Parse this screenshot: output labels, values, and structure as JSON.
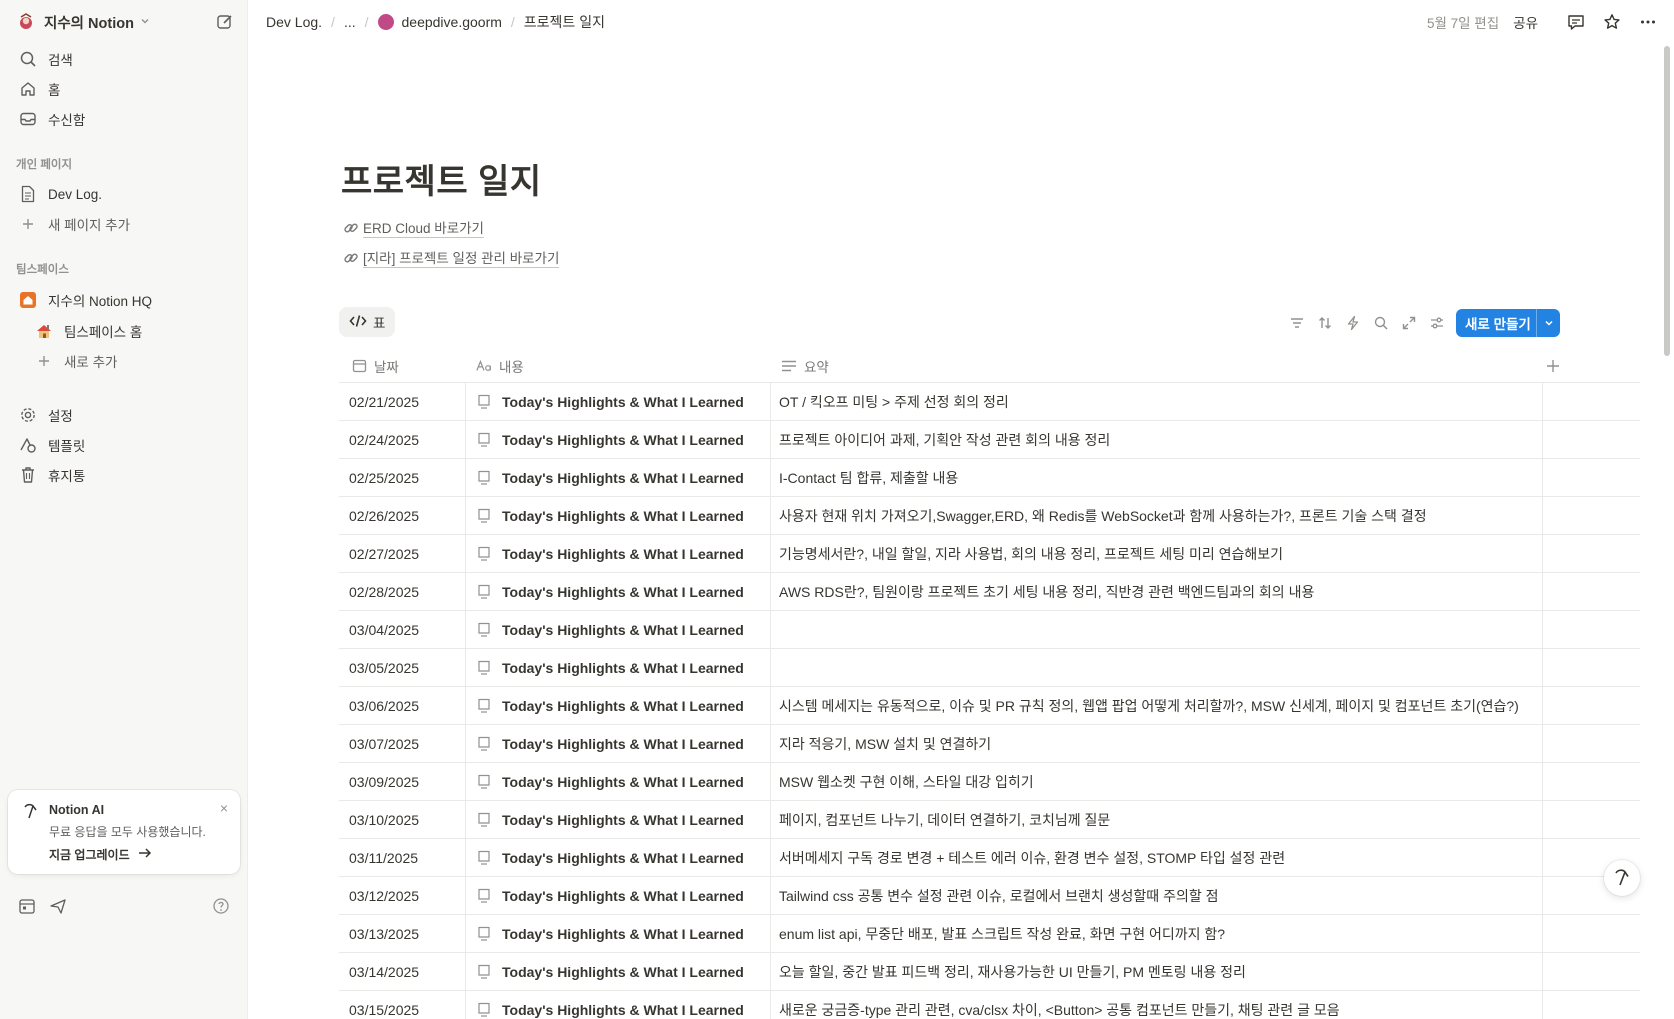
{
  "sidebar": {
    "workspace_name": "지수의 Notion",
    "nav": [
      {
        "label": "검색",
        "icon": "search-icon"
      },
      {
        "label": "홈",
        "icon": "home-icon"
      },
      {
        "label": "수신함",
        "icon": "inbox-icon"
      }
    ],
    "private_section": "개인 페이지",
    "private_pages": [
      {
        "label": "Dev Log.",
        "icon": "page-icon"
      },
      {
        "label": "새 페이지 추가",
        "icon": "plus-icon"
      }
    ],
    "teamspace_section": "팀스페이스",
    "teamspaces": [
      {
        "label": "지수의 Notion HQ",
        "icon": "hq-icon"
      },
      {
        "label": "팀스페이스 홈",
        "icon": "house-emoji-icon"
      },
      {
        "label": "새로 추가",
        "icon": "plus-icon"
      }
    ],
    "tools": [
      {
        "label": "설정",
        "icon": "gear-icon"
      },
      {
        "label": "템플릿",
        "icon": "template-icon"
      },
      {
        "label": "휴지통",
        "icon": "trash-icon"
      }
    ],
    "ai_card": {
      "title": "Notion AI",
      "description": "무료 응답을 모두 사용했습니다.",
      "upgrade": "지금 업그레이드",
      "close": "×"
    }
  },
  "topbar": {
    "breadcrumbs": [
      "Dev Log.",
      "...",
      "deepdive.goorm",
      "프로젝트 일지"
    ],
    "edited": "5월 7일 편집",
    "share": "공유"
  },
  "page": {
    "title": "프로젝트 일지",
    "links": [
      {
        "text": "ERD Cloud 바로가기",
        "icon": "link-icon"
      },
      {
        "text": "[지라] 프로젝트 일정 관리 바로가기",
        "icon": "link-icon"
      }
    ],
    "view_tab": "표",
    "new_button": "새로 만들기"
  },
  "table": {
    "columns": [
      {
        "label": "날짜",
        "icon": "calendar-icon"
      },
      {
        "label": "내용",
        "icon": "text-aa-icon"
      },
      {
        "label": "요약",
        "icon": "lines-icon"
      }
    ],
    "rows": [
      {
        "date": "02/21/2025",
        "title": "Today's Highlights & What I Learned",
        "summary": "OT / 킥오프 미팅 > 주제 선정 회의 정리"
      },
      {
        "date": "02/24/2025",
        "title": "Today's Highlights & What I Learned",
        "summary": "프로젝트 아이디어 과제, 기획안 작성 관련 회의 내용 정리"
      },
      {
        "date": "02/25/2025",
        "title": "Today's Highlights & What I Learned",
        "summary": "I-Contact 팀 합류, 제출할 내용"
      },
      {
        "date": "02/26/2025",
        "title": "Today's Highlights & What I Learned",
        "summary": "사용자 현재 위치 가져오기,Swagger,ERD, 왜 Redis를 WebSocket과 함께 사용하는가?, 프론트 기술 스택 결정"
      },
      {
        "date": "02/27/2025",
        "title": "Today's Highlights & What I Learned",
        "summary": "기능명세서란?, 내일 할일, 지라 사용법, 회의 내용 정리, 프로젝트 세팅 미리 연습해보기"
      },
      {
        "date": "02/28/2025",
        "title": "Today's Highlights & What I Learned",
        "summary": "AWS RDS란?, 팀원이랑 프로젝트 초기 세팅 내용 정리, 직반경 관련 백엔드팀과의 회의 내용"
      },
      {
        "date": "03/04/2025",
        "title": "Today's Highlights & What I Learned",
        "summary": ""
      },
      {
        "date": "03/05/2025",
        "title": "Today's Highlights & What I Learned",
        "summary": ""
      },
      {
        "date": "03/06/2025",
        "title": "Today's Highlights & What I Learned",
        "summary": "시스템 메세지는 유동적으로, 이슈 및 PR 규칙 정의, 웹앱 팝업 어떻게 처리할까?, MSW 신세계, 페이지 및 컴포넌트 초기(연습?)"
      },
      {
        "date": "03/07/2025",
        "title": "Today's Highlights & What I Learned",
        "summary": "지라 적응기, MSW 설치 및 연결하기"
      },
      {
        "date": "03/09/2025",
        "title": "Today's Highlights & What I Learned",
        "summary": "MSW 웹소켓 구현 이해, 스타일 대강 입히기"
      },
      {
        "date": "03/10/2025",
        "title": "Today's Highlights & What I Learned",
        "summary": "페이지, 컴포넌트 나누기, 데이터 연결하기, 코치님께 질문"
      },
      {
        "date": "03/11/2025",
        "title": "Today's Highlights & What I Learned",
        "summary": "서버메세지 구독 경로 변경 + 테스트 에러 이슈, 환경 변수 설정, STOMP 타입 설정 관련"
      },
      {
        "date": "03/12/2025",
        "title": "Today's Highlights & What I Learned",
        "summary": "Tailwind css 공통 변수 설정 관련 이슈, 로컬에서 브랜치 생성할때 주의할 점"
      },
      {
        "date": "03/13/2025",
        "title": "Today's Highlights & What I Learned",
        "summary": "enum list api, 무중단 배포, 발표 스크립트 작성 완료, 화면 구현 어디까지 함?"
      },
      {
        "date": "03/14/2025",
        "title": "Today's Highlights & What I Learned",
        "summary": "오늘 할일, 중간 발표 피드백 정리, 재사용가능한 UI 만들기, PM 멘토링 내용 정리"
      },
      {
        "date": "03/15/2025",
        "title": "Today's Highlights & What I Learned",
        "summary": "새로운 궁금증-type 관리 관련, cva/clsx 차이, <Button> 공통 컴포넌트 만들기, 채팅 관련 글 모음"
      }
    ]
  },
  "colors": {
    "accent": "#2383e2",
    "sidebar_bg": "#f7f7f5",
    "breadcrumb_dot": "#c14a86",
    "hq_icon": "#e8742a"
  }
}
